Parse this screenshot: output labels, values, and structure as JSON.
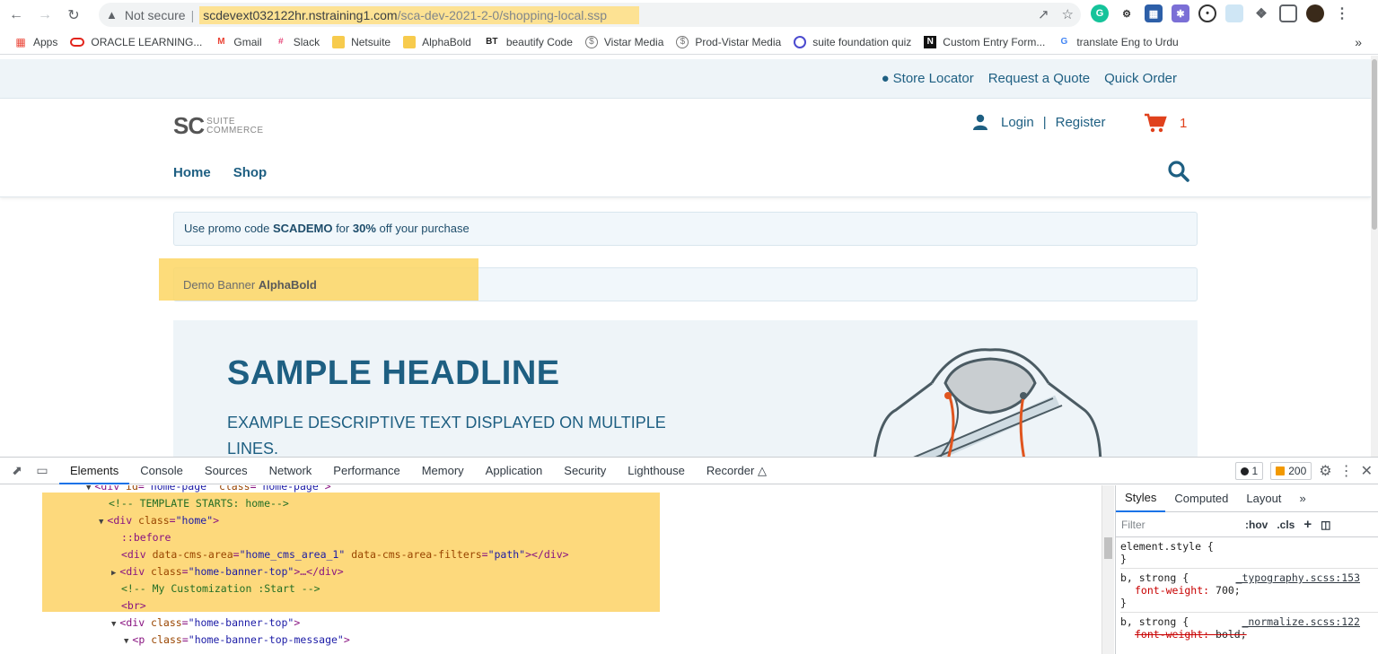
{
  "browser": {
    "omnibox": {
      "security": "Not secure",
      "url_host": "scdevext032122hr.nstraining1.com",
      "url_path": "/sca-dev-2021-2-0/shopping-local.ssp"
    },
    "bookmarks": [
      {
        "label": "Apps",
        "icon": "apps-grid-icon"
      },
      {
        "label": "ORACLE LEARNING...",
        "icon": "oracle-icon"
      },
      {
        "label": "Gmail",
        "icon": "gmail-icon"
      },
      {
        "label": "Slack",
        "icon": "slack-icon"
      },
      {
        "label": "Netsuite",
        "icon": "folder-icon"
      },
      {
        "label": "AlphaBold",
        "icon": "folder-icon"
      },
      {
        "label": "beautify Code",
        "icon": "bt-icon"
      },
      {
        "label": "Vistar Media",
        "icon": "vistar-icon"
      },
      {
        "label": "Prod-Vistar Media",
        "icon": "vistar-icon"
      },
      {
        "label": "suite foundation quiz",
        "icon": "quiz-icon"
      },
      {
        "label": "Custom Entry Form...",
        "icon": "notion-icon"
      },
      {
        "label": "translate Eng to Urdu",
        "icon": "google-icon"
      }
    ]
  },
  "site": {
    "toplinks": {
      "store_locator": "Store Locator",
      "request_quote": "Request a Quote",
      "quick_order": "Quick Order"
    },
    "logo": {
      "mark": "SC",
      "line1": "SUITE",
      "line2": "COMMERCE"
    },
    "user": {
      "login": "Login",
      "sep": "|",
      "register": "Register"
    },
    "cart_count": "1",
    "nav": {
      "home": "Home",
      "shop": "Shop"
    },
    "promo": {
      "pre": "Use promo code ",
      "code": "SCADEMO",
      "mid": " for ",
      "pct": "30%",
      "post": " off your purchase"
    },
    "demo_banner": {
      "pre": "Demo Banner ",
      "bold": "AlphaBold"
    },
    "hero": {
      "headline": "SAMPLE HEADLINE",
      "text": "EXAMPLE DESCRIPTIVE TEXT DISPLAYED ON MULTIPLE LINES."
    }
  },
  "devtools": {
    "tabs": [
      "Elements",
      "Console",
      "Sources",
      "Network",
      "Performance",
      "Memory",
      "Application",
      "Security",
      "Lighthouse",
      "Recorder"
    ],
    "active_tab": "Elements",
    "errors": "1",
    "warnings": "200",
    "dom_lines": [
      {
        "text_tag_open": "<div ",
        "attrs": "id=\"home-page\" class=\"home-page\"",
        "text_tag_close": ">"
      },
      {
        "comment": "<!-- TEMPLATE STARTS: home-->"
      },
      {
        "tag": "div",
        "attr_name": "class",
        "attr_val": "\"home\""
      },
      {
        "pseudo": "::before"
      },
      {
        "tag": "div",
        "attr_name": "data-cms-area",
        "attr_val": "\"home_cms_area_1\"",
        "attr_name2": "data-cms-area-filters",
        "attr_val2": "\"path\""
      },
      {
        "tag": "div",
        "attr_name": "class",
        "attr_val": "\"home-banner-top\""
      },
      {
        "comment": "<!-- My Customization :Start -->"
      },
      {
        "tag": "br"
      },
      {
        "tag": "div",
        "attr_name": "class",
        "attr_val": "\"home-banner-top\""
      },
      {
        "tag": "p",
        "attr_name": "class",
        "attr_val": "\"home-banner-top-message\""
      }
    ],
    "styles_tabs": [
      "Styles",
      "Computed",
      "Layout"
    ],
    "filter_placeholder": "Filter",
    "hov": ":hov",
    "cls": ".cls",
    "rules": [
      {
        "selector": "element.style {",
        "close": "}"
      },
      {
        "selector": "b, strong {",
        "source": "_typography.scss:153",
        "prop": "font-weight",
        "value": "700;",
        "close": "}"
      },
      {
        "selector": "b, strong {",
        "source": "_normalize.scss:122",
        "prop": "font-weight",
        "value": "bold;"
      }
    ]
  },
  "colors": {
    "brand_blue": "#1e5f82",
    "cart_red": "#e0411c",
    "highlight": "#fdd97c"
  }
}
